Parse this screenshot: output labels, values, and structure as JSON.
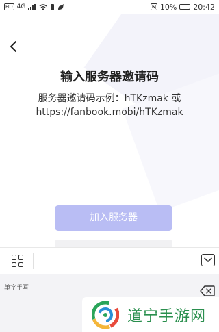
{
  "status_bar": {
    "hd_badge": "HD",
    "signal_label": "4G",
    "battery_percent": "10%",
    "time": "20:42"
  },
  "page": {
    "title": "输入服务器邀请码",
    "hint_line1": "服务器邀请码示例：hTKzmak 或",
    "hint_line2": "https://fanbook.mobi/hTKzmak",
    "invite_input": {
      "value": "",
      "placeholder": ""
    },
    "join_button_label": "加入服务器"
  },
  "keyboard": {
    "panel_label": "单字手写"
  },
  "watermark": {
    "text": "道宁手游网"
  },
  "colors": {
    "accent_disabled": "#b9bdf4",
    "watermark_green": "#2a8f4e"
  }
}
